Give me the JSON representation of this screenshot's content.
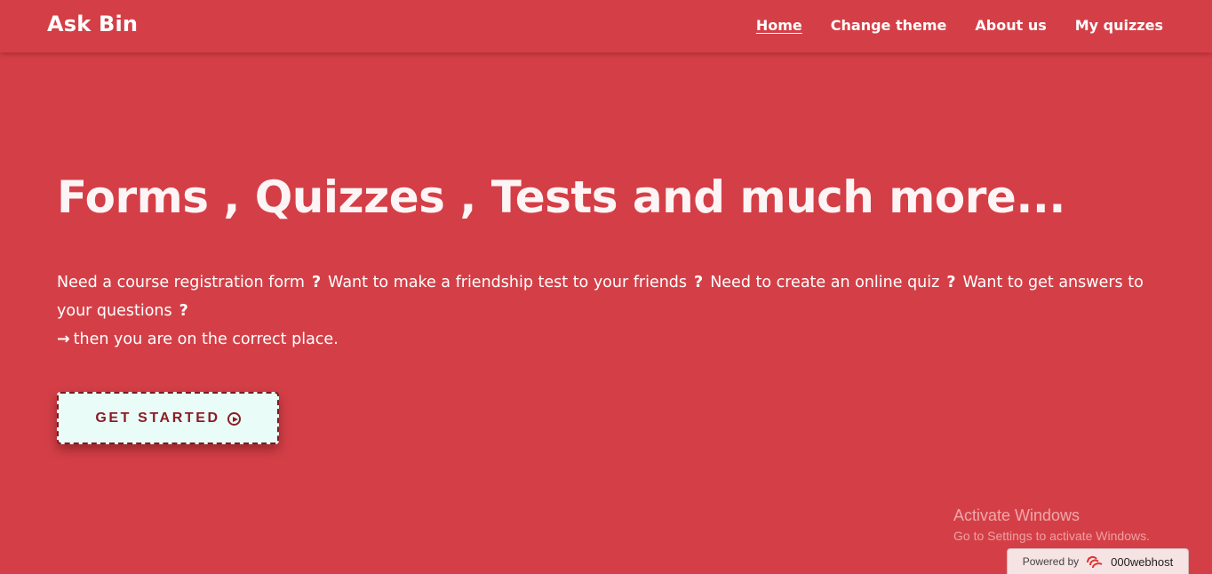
{
  "header": {
    "brand": "Ask Bin",
    "nav": [
      {
        "label": "Home",
        "active": true
      },
      {
        "label": "Change theme",
        "active": false
      },
      {
        "label": "About us",
        "active": false
      },
      {
        "label": "My quizzes",
        "active": false
      }
    ]
  },
  "hero": {
    "title": "Forms , Quizzes , Tests and much more...",
    "question_icon": "question-mark-icon",
    "questions": [
      "Need a course registration form",
      "Want to make a friendship test to your friends",
      "Need to create an online quiz",
      "Want to get answers to your questions"
    ],
    "arrow_icon": "arrow-right-icon",
    "conclusion": "then you are on the correct place.",
    "cta_label": "GET STARTED",
    "cta_icon": "play-circle-icon"
  },
  "watermark": {
    "title": "Activate Windows",
    "subtitle": "Go to Settings to activate Windows."
  },
  "host_badge": {
    "prefix": "Powered by",
    "brand": "000webhost",
    "logo": "000webhost-logo"
  },
  "colors": {
    "background": "#d43f47",
    "button_bg": "#eafcf8",
    "button_text": "#8b1c25"
  }
}
